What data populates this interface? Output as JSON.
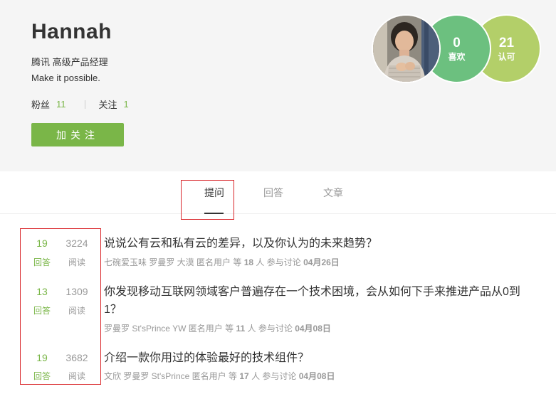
{
  "profile": {
    "name": "Hannah",
    "title": "腾讯 高级产品经理",
    "motto": "Make it possible.",
    "fans_label": "粉丝",
    "fans_count": "11",
    "following_label": "关注",
    "following_count": "1",
    "follow_button": "加关注"
  },
  "badges": {
    "likes_count": "0",
    "likes_label": "喜欢",
    "approvals_count": "21",
    "approvals_label": "认可"
  },
  "tabs": [
    {
      "label": "提问",
      "active": true
    },
    {
      "label": "回答",
      "active": false
    },
    {
      "label": "文章",
      "active": false
    }
  ],
  "questions": [
    {
      "answers": "19",
      "answers_label": "回答",
      "views": "3224",
      "views_label": "阅读",
      "title": "说说公有云和私有云的差异，以及你认为的未来趋势？",
      "participants": "七碗爱玉味 罗曼罗 大漠 匿名用户",
      "count_prefix": "等",
      "count": "18",
      "count_suffix": "人 参与讨论",
      "date": "04月26日"
    },
    {
      "answers": "13",
      "answers_label": "回答",
      "views": "1309",
      "views_label": "阅读",
      "title": "你发现移动互联网领域客户普遍存在一个技术困境，会从如何下手来推进产品从0到1？",
      "participants": "罗曼罗 St'sPrince YW 匿名用户",
      "count_prefix": "等",
      "count": "11",
      "count_suffix": "人 参与讨论",
      "date": "04月08日"
    },
    {
      "answers": "19",
      "answers_label": "回答",
      "views": "3682",
      "views_label": "阅读",
      "title": "介绍一款你用过的体验最好的技术组件？",
      "participants": "文欣 罗曼罗 St'sPrince 匿名用户",
      "count_prefix": "等",
      "count": "17",
      "count_suffix": "人 参与讨论",
      "date": "04月08日"
    }
  ],
  "colors": {
    "accent_green": "#7ab648",
    "likes_badge": "#6cc07f",
    "approvals_badge": "#b3cf69",
    "highlight_red": "#d9262a"
  }
}
